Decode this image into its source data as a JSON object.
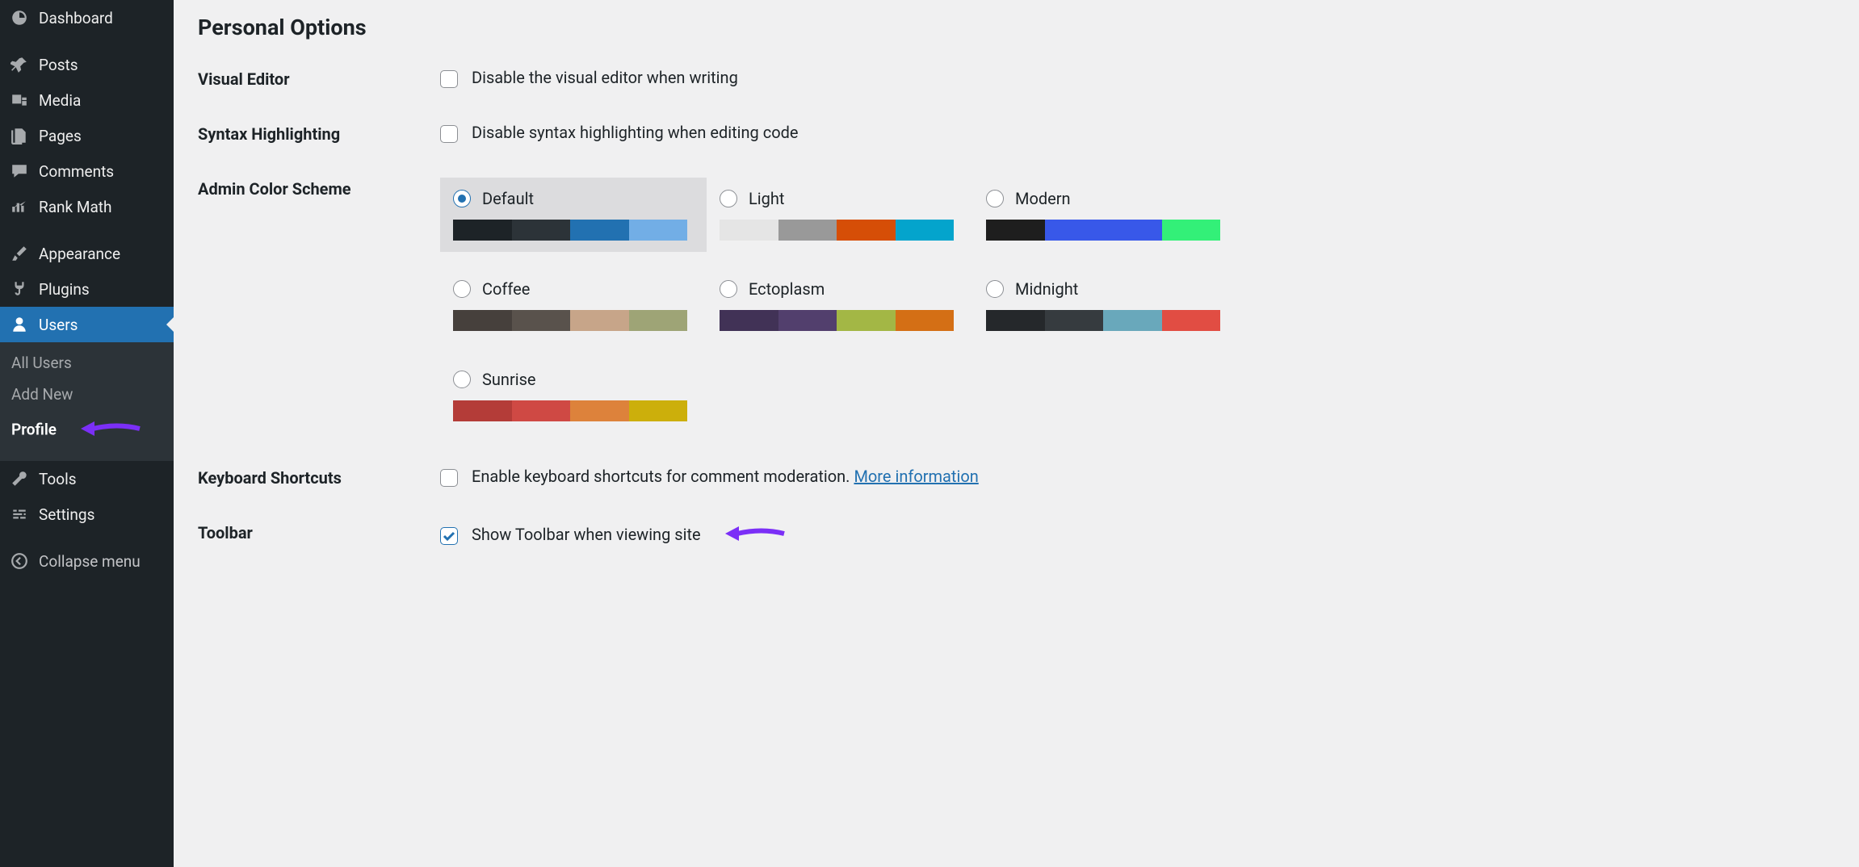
{
  "sidebar": {
    "items": [
      {
        "id": "dashboard",
        "label": "Dashboard",
        "icon": "dashboard"
      },
      {
        "id": "posts",
        "label": "Posts",
        "icon": "pin"
      },
      {
        "id": "media",
        "label": "Media",
        "icon": "media"
      },
      {
        "id": "pages",
        "label": "Pages",
        "icon": "pages"
      },
      {
        "id": "comments",
        "label": "Comments",
        "icon": "comment"
      },
      {
        "id": "rankmath",
        "label": "Rank Math",
        "icon": "chart"
      },
      {
        "id": "appearance",
        "label": "Appearance",
        "icon": "brush"
      },
      {
        "id": "plugins",
        "label": "Plugins",
        "icon": "plug"
      },
      {
        "id": "users",
        "label": "Users",
        "icon": "user",
        "active": true
      },
      {
        "id": "tools",
        "label": "Tools",
        "icon": "wrench"
      },
      {
        "id": "settings",
        "label": "Settings",
        "icon": "sliders"
      }
    ],
    "submenu": {
      "all_users": "All Users",
      "add_new": "Add New",
      "profile": "Profile"
    },
    "collapse": "Collapse menu"
  },
  "section_title": "Personal Options",
  "rows": {
    "visual_editor": {
      "label": "Visual Editor",
      "text": "Disable the visual editor when writing",
      "checked": false
    },
    "syntax": {
      "label": "Syntax Highlighting",
      "text": "Disable syntax highlighting when editing code",
      "checked": false
    },
    "color_scheme": {
      "label": "Admin Color Scheme"
    },
    "keyboard": {
      "label": "Keyboard Shortcuts",
      "text": "Enable keyboard shortcuts for comment moderation.",
      "link": "More information",
      "checked": false
    },
    "toolbar": {
      "label": "Toolbar",
      "text": "Show Toolbar when viewing site",
      "checked": true
    }
  },
  "schemes": [
    {
      "name": "Default",
      "selected": true,
      "colors": [
        "#1d2327",
        "#2c3338",
        "#2271b1",
        "#72aee6"
      ]
    },
    {
      "name": "Light",
      "selected": false,
      "colors": [
        "#e5e5e5",
        "#999999",
        "#d64e07",
        "#04a4cc"
      ]
    },
    {
      "name": "Modern",
      "selected": false,
      "colors": [
        "#1e1e1e",
        "#3858e9",
        "#3858e9",
        "#33f078"
      ]
    },
    {
      "name": "Coffee",
      "selected": false,
      "colors": [
        "#46403c",
        "#59524c",
        "#c7a589",
        "#9ea476"
      ]
    },
    {
      "name": "Ectoplasm",
      "selected": false,
      "colors": [
        "#413256",
        "#523f6d",
        "#a3b745",
        "#d46f15"
      ]
    },
    {
      "name": "Midnight",
      "selected": false,
      "colors": [
        "#25282b",
        "#363b3f",
        "#69a8bb",
        "#e14d43"
      ]
    },
    {
      "name": "Sunrise",
      "selected": false,
      "colors": [
        "#b43c38",
        "#cf4944",
        "#dd823b",
        "#ccaf0b"
      ]
    }
  ]
}
